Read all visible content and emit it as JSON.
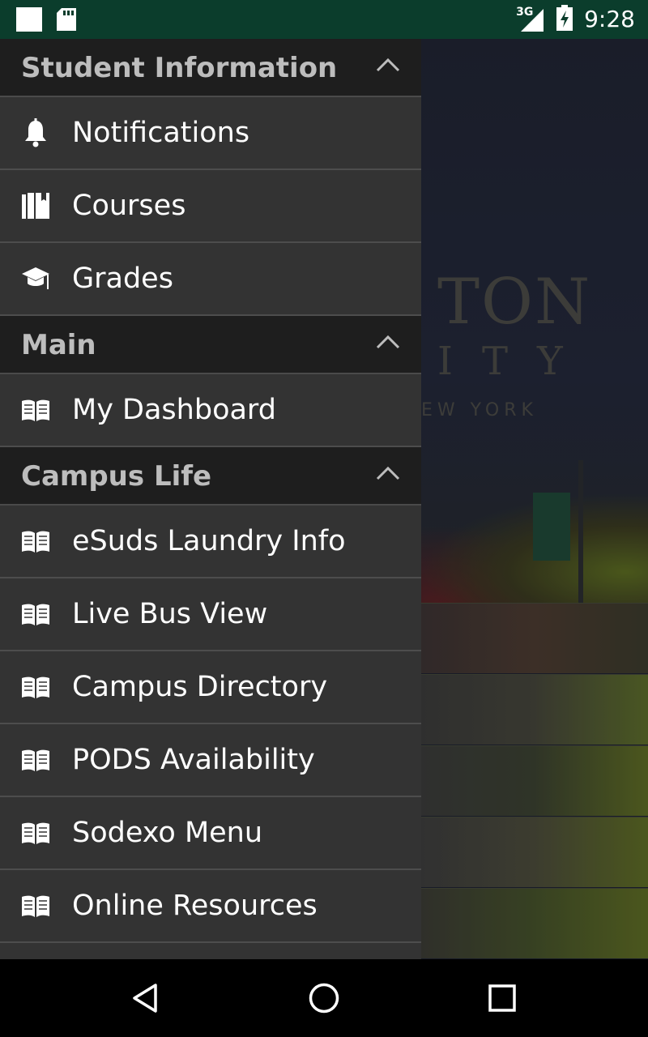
{
  "status_bar": {
    "network": "3G",
    "time": "9:28"
  },
  "background": {
    "line1": "TON",
    "line2": "ITY",
    "line3": "EW YORK"
  },
  "drawer": {
    "sections": [
      {
        "title": "Student Information",
        "items": [
          {
            "label": "Notifications",
            "icon": "bell-icon"
          },
          {
            "label": "Courses",
            "icon": "books-icon"
          },
          {
            "label": "Grades",
            "icon": "graduation-cap-icon"
          }
        ]
      },
      {
        "title": "Main",
        "items": [
          {
            "label": "My Dashboard",
            "icon": "open-book-icon"
          }
        ]
      },
      {
        "title": "Campus Life",
        "items": [
          {
            "label": "eSuds Laundry Info",
            "icon": "open-book-icon"
          },
          {
            "label": "Live Bus View",
            "icon": "open-book-icon"
          },
          {
            "label": "Campus Directory",
            "icon": "open-book-icon"
          },
          {
            "label": "PODS Availability",
            "icon": "open-book-icon"
          },
          {
            "label": "Sodexo Menu",
            "icon": "open-book-icon"
          },
          {
            "label": "Online Resources",
            "icon": "open-book-icon"
          }
        ]
      }
    ]
  },
  "colors": {
    "status_bar": "#0b3d2c",
    "drawer_bg": "#333333",
    "section_header_bg": "#1e1e1e",
    "section_title": "#bdbdbd"
  }
}
